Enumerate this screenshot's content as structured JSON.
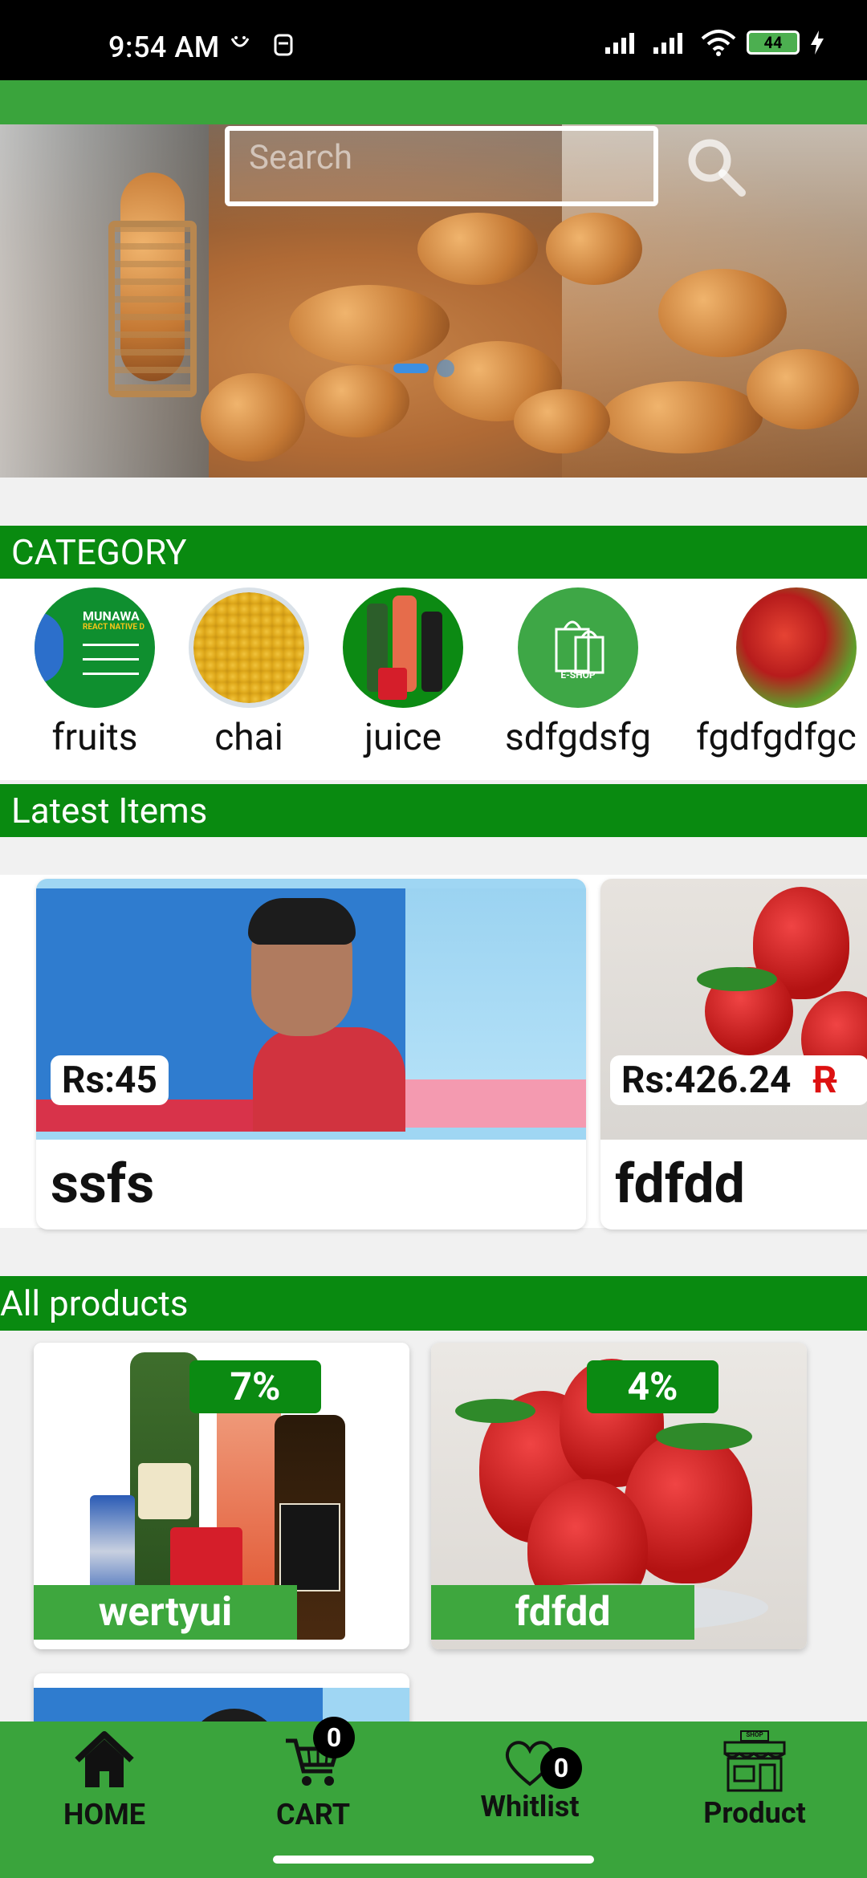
{
  "status_bar": {
    "time": "9:54 AM",
    "battery": "44"
  },
  "search": {
    "placeholder": "Search"
  },
  "sections": {
    "category": "CATEGORY",
    "latest": "Latest Items",
    "all_products": "All products"
  },
  "categories": [
    {
      "label": "fruits"
    },
    {
      "label": "chai"
    },
    {
      "label": "juice"
    },
    {
      "label": "sdfgdsfg"
    },
    {
      "label": "fgdfgdfgc"
    }
  ],
  "category_images": {
    "fruits_brand": "MUNAWA",
    "fruits_brand_sub": "REACT NATIVE D",
    "eshop_label": "E-SHOP"
  },
  "latest_items": [
    {
      "price": "Rs:45",
      "title": "ssfs"
    },
    {
      "price": "Rs:426.24",
      "old_price": "R",
      "title": "fdfdd"
    }
  ],
  "products": [
    {
      "discount": "7%",
      "name": "wertyui"
    },
    {
      "discount": "4%",
      "name": "fdfdd"
    }
  ],
  "bottom_nav": {
    "home": "HOME",
    "cart": "CART",
    "cart_count": "0",
    "wishlist": "Whitlist",
    "wishlist_count": "0",
    "product": "Product",
    "shop_sign": "SHOP"
  },
  "colors": {
    "primary_green": "#3aa43c",
    "header_green": "#098a10",
    "discount_green": "#0b8a12",
    "dot_blue": "#3d8fe0"
  }
}
